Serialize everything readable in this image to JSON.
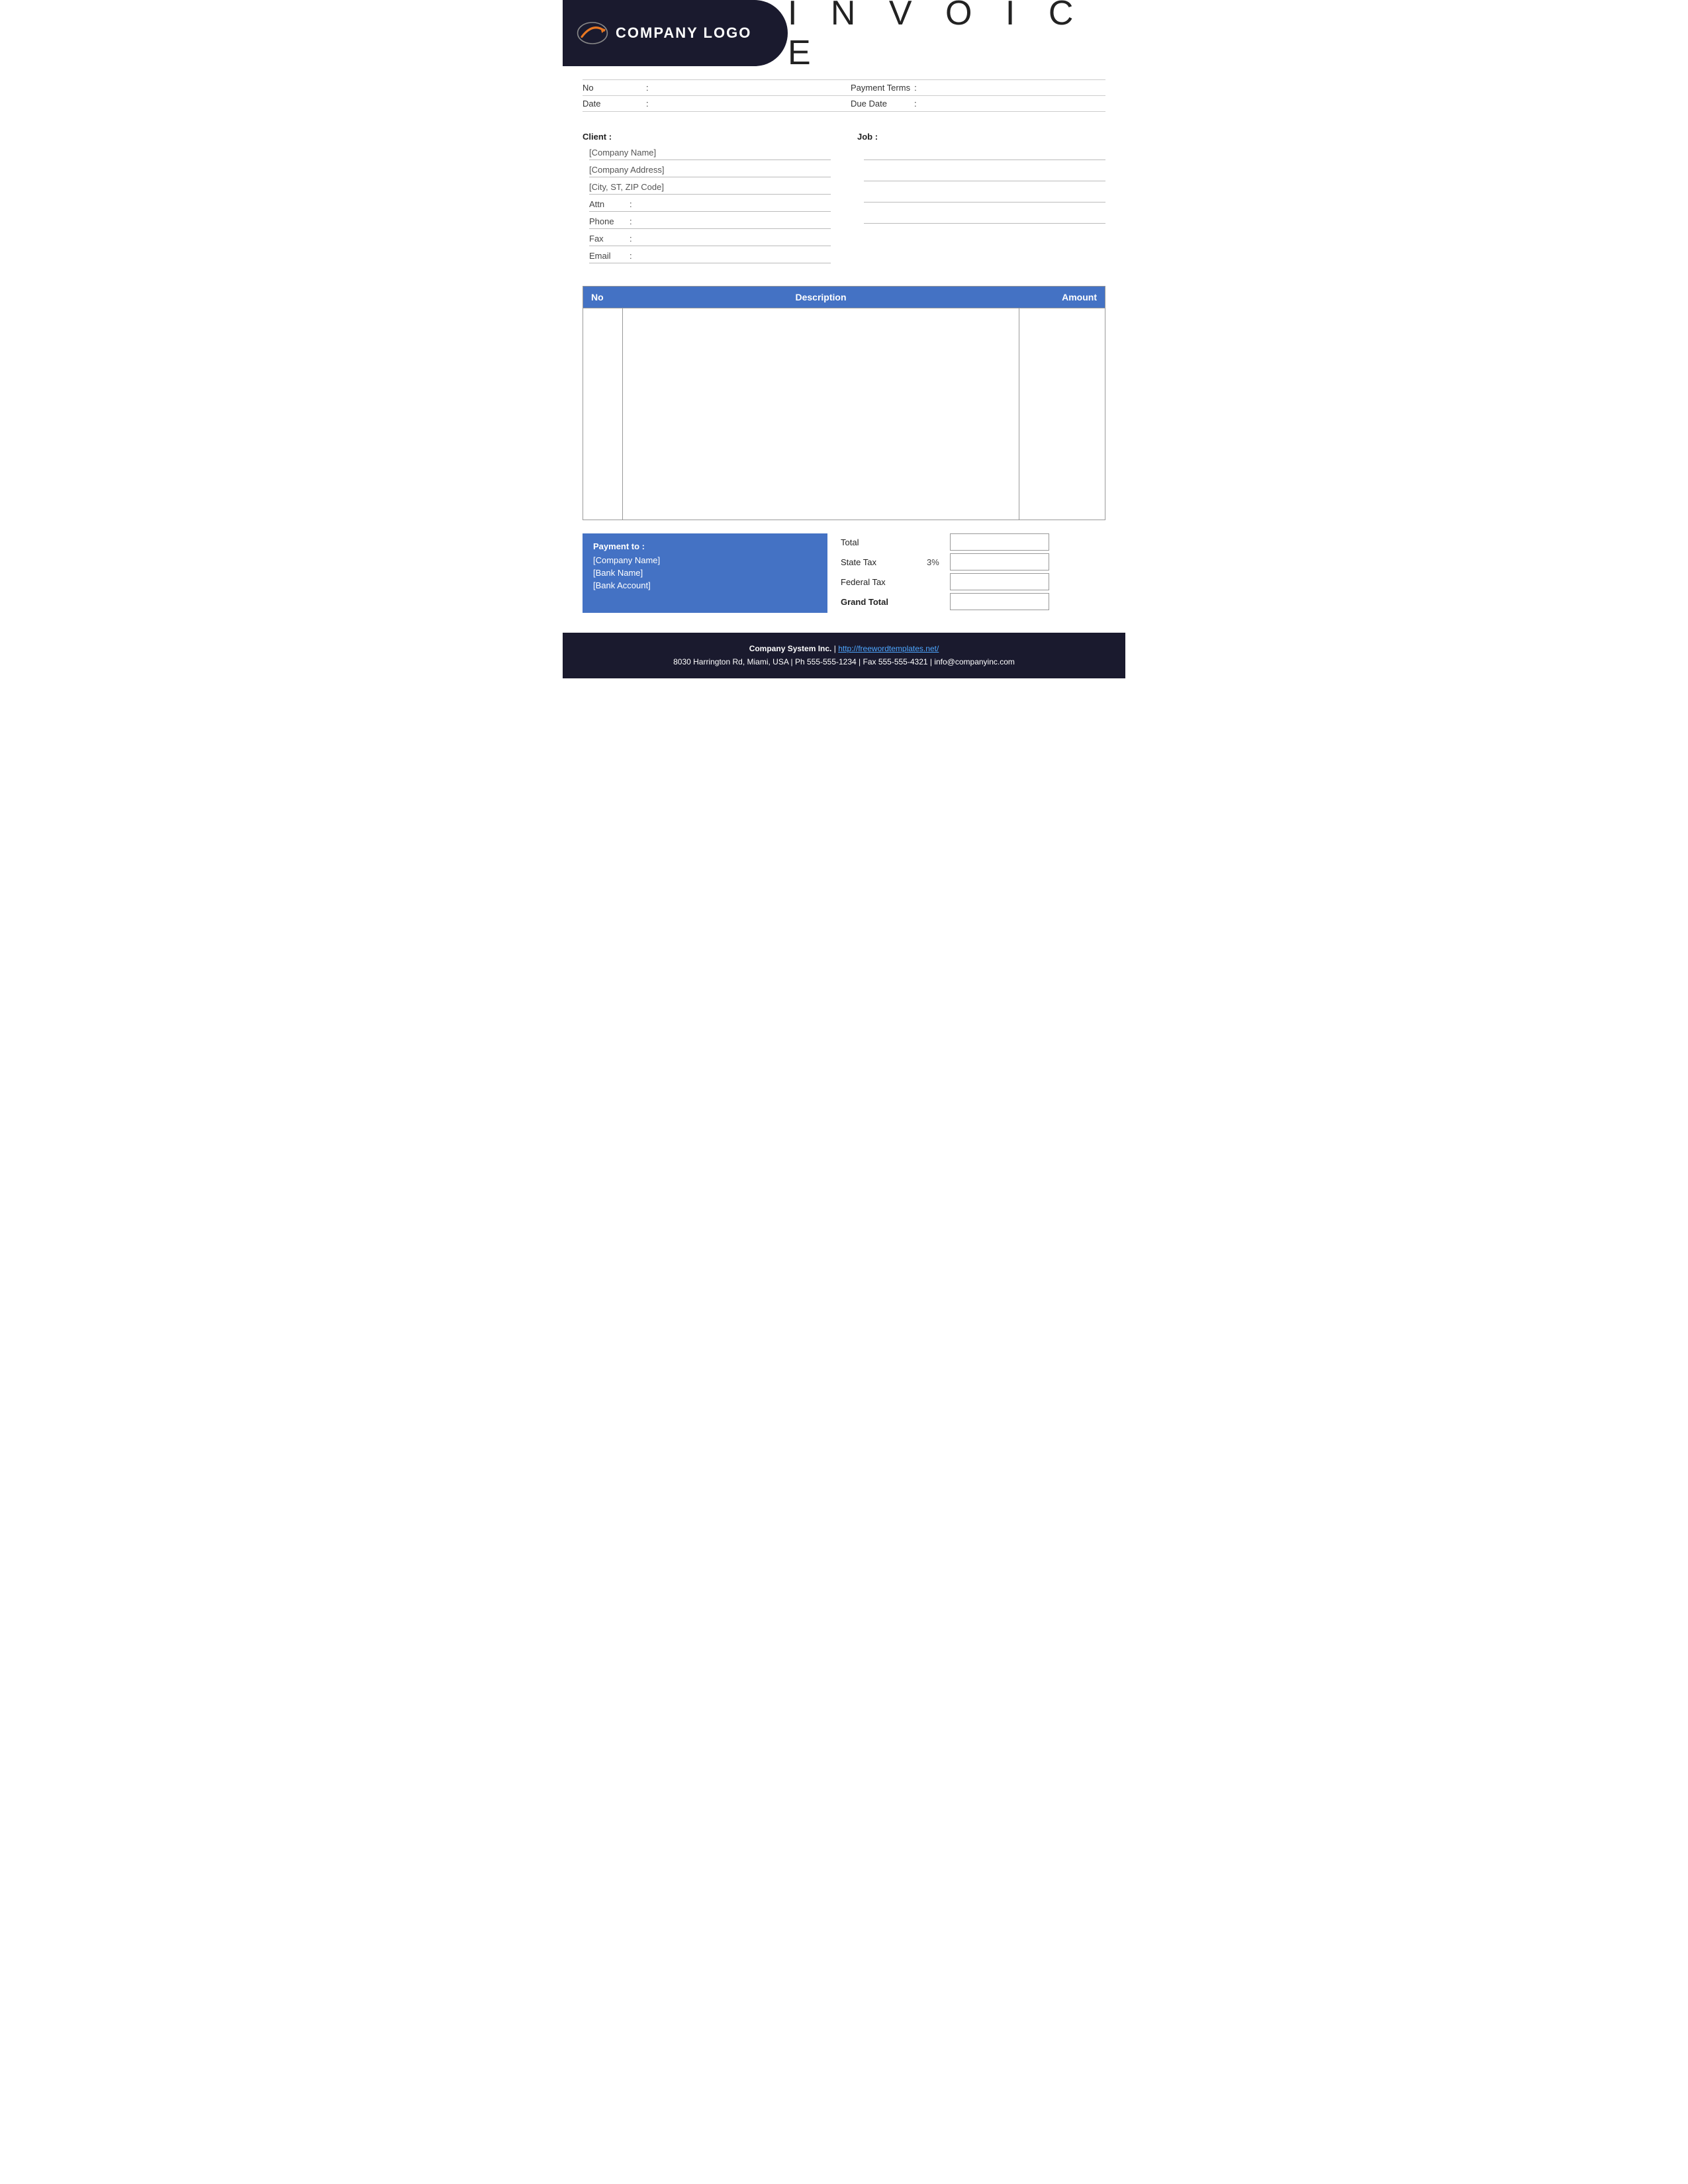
{
  "header": {
    "logo_text": "COMPANY LOGO",
    "invoice_title": "I N V O I C E"
  },
  "meta": {
    "no_label": "No",
    "no_colon": ":",
    "no_value": "",
    "payment_terms_label": "Payment  Terms",
    "payment_terms_colon": ":",
    "payment_terms_value": "",
    "date_label": "Date",
    "date_colon": ":",
    "date_value": "",
    "due_date_label": "Due Date",
    "due_date_colon": ":",
    "due_date_value": ""
  },
  "client": {
    "label": "Client :",
    "company_name": "[Company Name]",
    "company_address": "[Company Address]",
    "city_zip": "[City, ST, ZIP Code]",
    "attn_label": "Attn",
    "attn_colon": ":",
    "attn_value": "",
    "phone_label": "Phone",
    "phone_colon": ":",
    "phone_value": "",
    "fax_label": "Fax",
    "fax_colon": ":",
    "fax_value": "",
    "email_label": "Email",
    "email_colon": ":",
    "email_value": ""
  },
  "job": {
    "label": "Job :",
    "lines": [
      "",
      "",
      "",
      ""
    ]
  },
  "table": {
    "col_no": "No",
    "col_description": "Description",
    "col_amount": "Amount"
  },
  "payment": {
    "title": "Payment to :",
    "company_name": "[Company Name]",
    "bank_name": "[Bank Name]",
    "bank_account": "[Bank Account]"
  },
  "totals": {
    "total_label": "Total",
    "state_tax_label": "State Tax",
    "state_tax_percent": "3%",
    "federal_tax_label": "Federal Tax",
    "grand_total_label": "Grand Total"
  },
  "footer": {
    "company": "Company System Inc.",
    "separator": "|",
    "website": "http://freewordtemplates.net/",
    "address": "8030 Harrington Rd, Miami, USA | Ph 555-555-1234 | Fax 555-555-4321 | info@companyinc.com"
  }
}
